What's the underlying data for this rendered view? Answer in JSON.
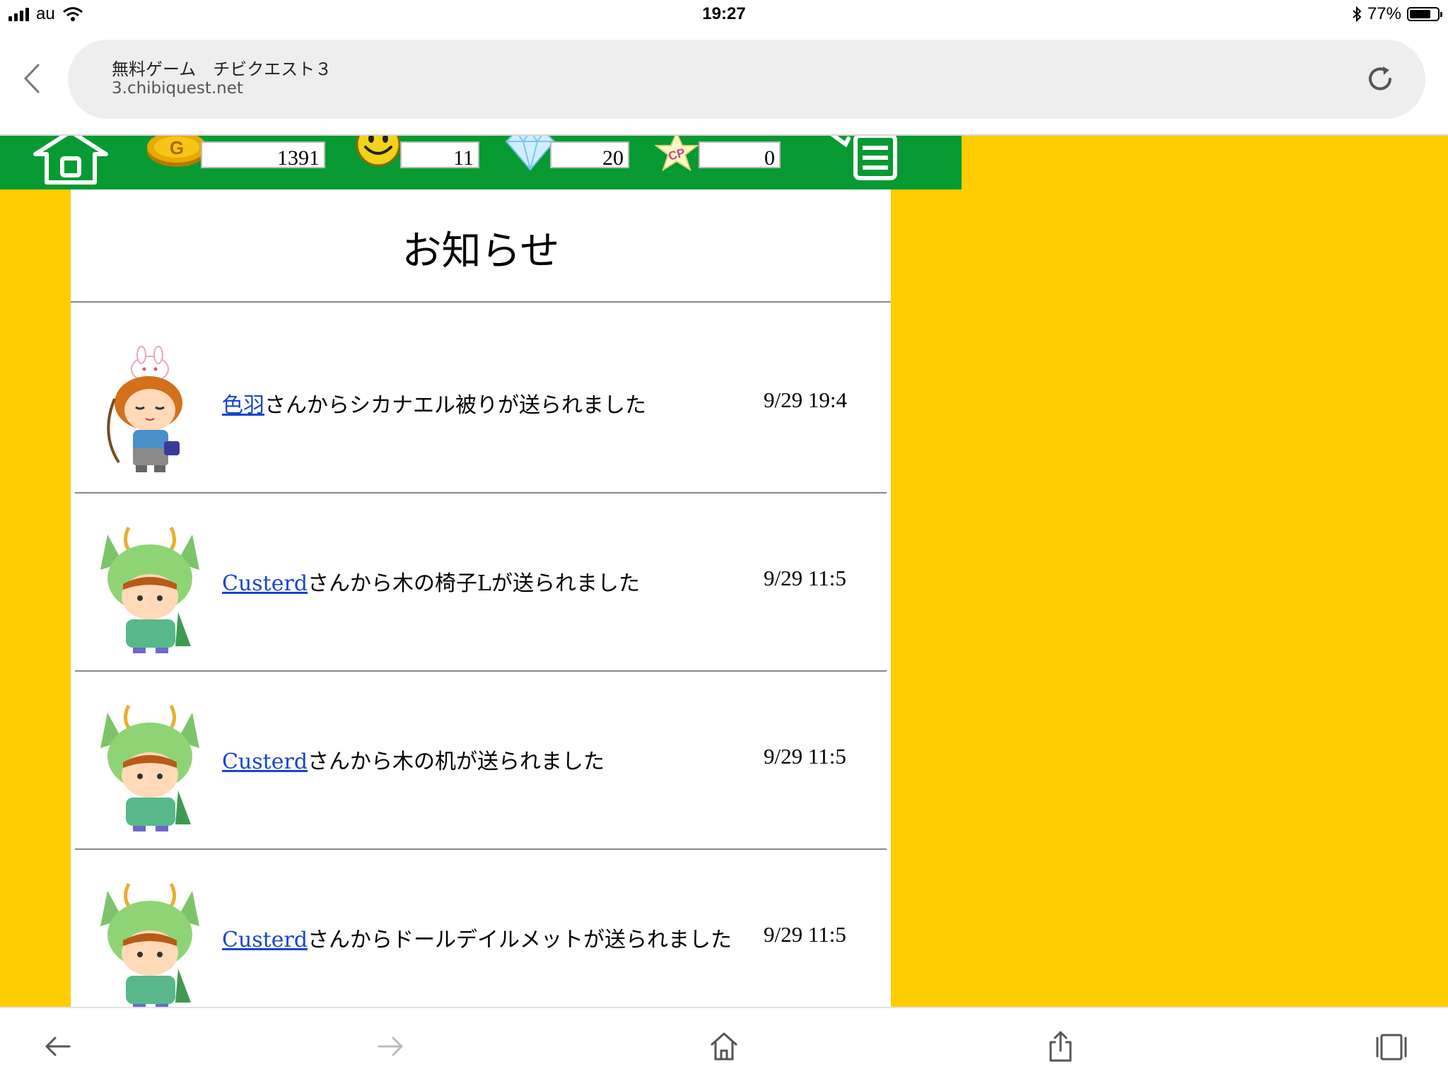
{
  "status_bar": {
    "carrier": "au",
    "time": "19:27",
    "battery_percent": "77%",
    "battery_level": 0.77,
    "icons": [
      "signal-icon",
      "wifi-icon",
      "bluetooth-icon",
      "battery-icon"
    ]
  },
  "browser": {
    "page_title": "無料ゲーム　チビクエスト３",
    "url": "3.chibiquest.net"
  },
  "game_header": {
    "gold": "1391",
    "smile": "11",
    "diamond": "20",
    "cp": "0",
    "icons": [
      "home-icon",
      "gold-coin-icon",
      "smile-icon",
      "diamond-icon",
      "cp-star-icon",
      "menu-list-icon"
    ]
  },
  "notices": {
    "title": "お知らせ",
    "items": [
      {
        "sender": "色羽",
        "message": "さんからシカナエル被りが送られました",
        "date": "9/29 19:4",
        "avatar": "chibi-bunny-hat-avatar"
      },
      {
        "sender": "Custerd",
        "message": "さんから木の椅子Lが送られました",
        "date": "9/29 11:5",
        "avatar": "chibi-dragon-hood-avatar"
      },
      {
        "sender": "Custerd",
        "message": "さんから木の机が送られました",
        "date": "9/29 11:5",
        "avatar": "chibi-dragon-hood-avatar"
      },
      {
        "sender": "Custerd",
        "message": "さんからドールデイルメットが送られました",
        "date": "9/29 11:5",
        "avatar": "chibi-dragon-hood-avatar"
      }
    ]
  },
  "colors": {
    "page_background": "#ffcc00",
    "header_green": "#079a32",
    "link_blue": "#1a44cc"
  }
}
